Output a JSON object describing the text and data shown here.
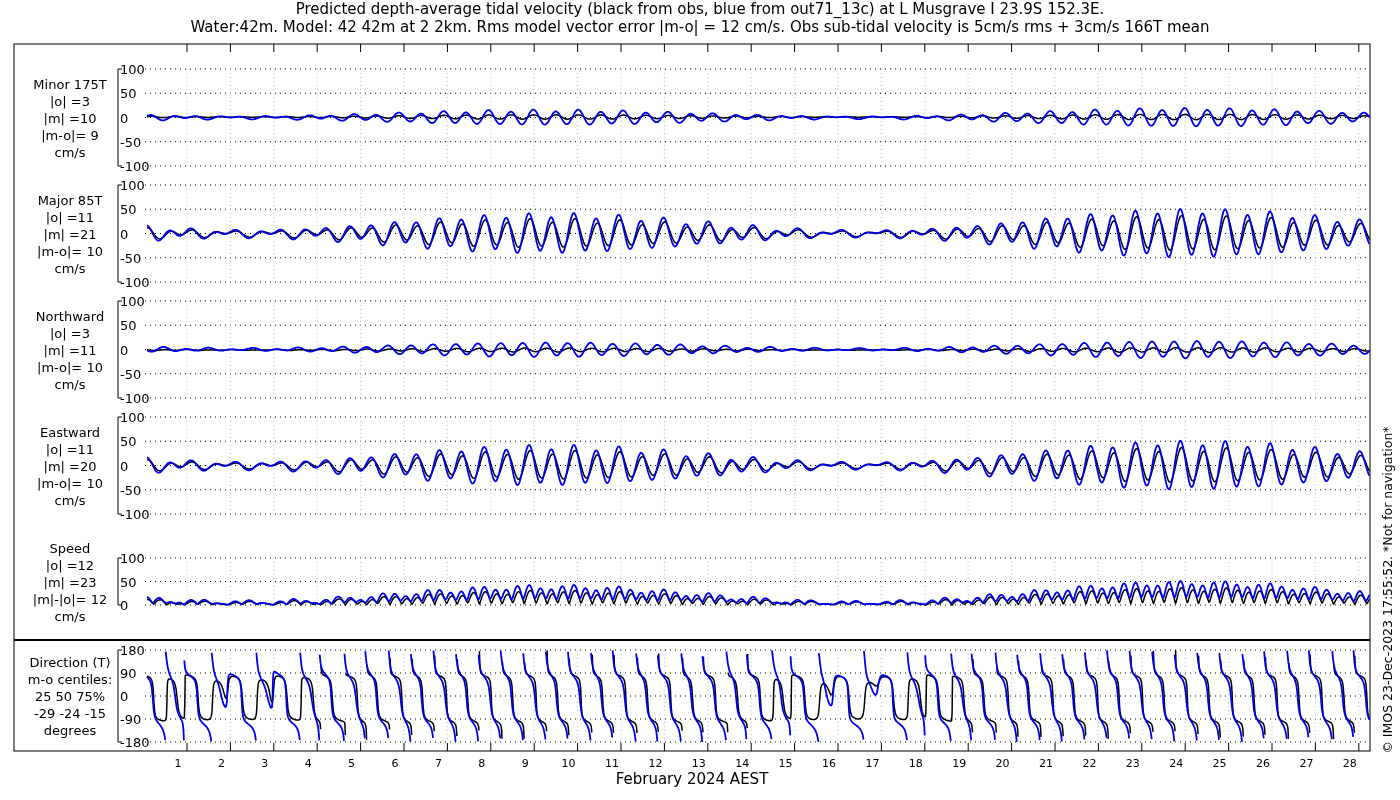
{
  "title_lines": [
    "Predicted depth-average tidal velocity (black from obs, blue from out71_13c) at L Musgrave I 23.9S 152.3E.",
    "Water:42m. Model: 42 42m at 2 2km. Rms model vector error |m-o| = 12 cm/s. Obs sub-tidal velocity is 5cm/s rms + 3cm/s 166T mean"
  ],
  "panels": [
    {
      "kind": "minor",
      "label_lines": [
        "Minor 175T",
        "|o| =3",
        "|m| =10",
        "|m-o|= 9",
        "cm/s"
      ],
      "yticks": [
        "100",
        "50",
        "0",
        "-50",
        "-100"
      ]
    },
    {
      "kind": "major",
      "label_lines": [
        "Major 85T",
        "|o| =11",
        "|m| =21",
        "|m-o|= 10",
        "cm/s"
      ],
      "yticks": [
        "100",
        "50",
        "0",
        "-50",
        "-100"
      ]
    },
    {
      "kind": "northward",
      "label_lines": [
        "Northward",
        "|o| =3",
        "|m| =11",
        "|m-o|= 10",
        "cm/s"
      ],
      "yticks": [
        "100",
        "50",
        "0",
        "-50",
        "-100"
      ]
    },
    {
      "kind": "eastward",
      "label_lines": [
        "Eastward",
        "|o| =11",
        "|m| =20",
        "|m-o|= 10",
        "cm/s"
      ],
      "yticks": [
        "100",
        "50",
        "0",
        "-50",
        "-100"
      ]
    },
    {
      "kind": "speed",
      "label_lines": [
        "Speed",
        "|o| =12",
        "|m| =23",
        "|m|-|o|= 12",
        "cm/s"
      ],
      "yticks": [
        "100",
        "50",
        "0"
      ]
    },
    {
      "kind": "direction",
      "label_lines": [
        "Direction (T)",
        "m-o centiles:",
        "25  50  75%",
        "-29 -24 -15",
        "degrees"
      ],
      "yticks": [
        "180",
        "90",
        "0",
        "-90",
        "-180"
      ]
    }
  ],
  "x_axis": {
    "ticks": [
      "1",
      "2",
      "3",
      "4",
      "5",
      "6",
      "7",
      "8",
      "9",
      "10",
      "11",
      "12",
      "13",
      "14",
      "15",
      "16",
      "17",
      "18",
      "19",
      "20",
      "21",
      "22",
      "23",
      "24",
      "25",
      "26",
      "27",
      "28"
    ],
    "xlabel": "February 2024 AEST"
  },
  "credit": "© IMOS 23-Dec-2023 17:55:52.  *Not for navigation*"
}
